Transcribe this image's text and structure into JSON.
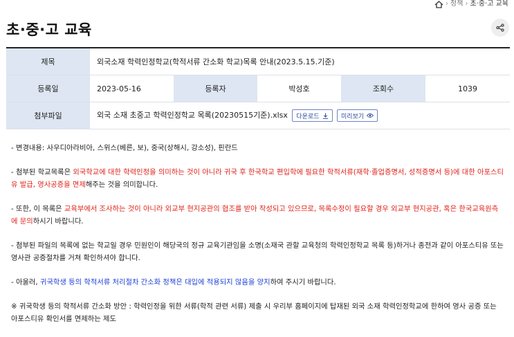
{
  "breadcrumb": {
    "items": [
      "정책",
      "초·중·고 교육"
    ]
  },
  "page_title": "초·중·고 교육",
  "table": {
    "title_label": "제목",
    "title_value": "외국소재 학력인정학교(학적서류 간소화 학교)목록 안내(2023.5.15.기준)",
    "date_label": "등록일",
    "date_value": "2023-05-16",
    "author_label": "등록자",
    "author_value": "박성호",
    "views_label": "조회수",
    "views_value": "1039",
    "file_label": "첨부파일",
    "file_name": "외국 소재 초중고 학력인정학교 목록(20230515기준).xlsx",
    "download_label": "다운로드",
    "preview_label": "미리보기"
  },
  "content": {
    "p1": "- 변경내용: 사우디아라비아, 스위스(베른, 보), 중국(상해시, 강소성), 핀란드",
    "p2_a": "- 첨부된 학교목록은 ",
    "p2_red": "외국학교에 대한 학력인정을 의미하는 것이 아니라 귀국 후 한국학교 편입학에 필요한 학적서류(재학·졸업증명서, 성적증명서 등)에 대한 아포스티유 발급, 영사공증을 면제",
    "p2_b": "해주는 것을 의미합니다.",
    "p3_a": "- 또한, 이 목록은 ",
    "p3_red": "교육부에서 조사하는 것이 아니라 외교부 현지공관의 협조를 받아 작성되고 있으므로, 목록수정이 필요할 경우 외교부 현지공관, 혹은 한국교육원측에 문의",
    "p3_b": "하시기 바랍니다.",
    "p4": "- 첨부된 파일의 목록에 없는 학교일 경우 민원인이 해당국의 정규 교육기관임을 소명(소재국 관할 교육청의 학력인정학교 목록 등)하거나 종전과 같이 아포스티유 또는 영사관 공증절차를 거쳐 확인하셔야 합니다.",
    "p5_a": "- 아울러, ",
    "p5_blue": "귀국학생 등의 학적서류 처리절차 간소화 정책은 대입에 적용되지 않음을 양지",
    "p5_b": "하여 주시기 바랍니다.",
    "p6": "※ 귀국학생 등의 학적서류 간소화 방안 : 학력인정을 위한 서류(학적 관련 서류) 제출 시 우리부 홈페이지에 탑재된 외국 소재 학력인정학교에 한하여 영사 공증 또는 아포스티유 확인서를 면제하는 제도"
  },
  "colors": {
    "header_cell": "#dde6f2",
    "red_text": "#e0231a",
    "blue_text": "#1f3fd6",
    "button_border": "#6d85c7"
  },
  "icons": {
    "home": "home-icon",
    "share": "share-icon",
    "download": "download-icon",
    "preview": "eye-icon"
  }
}
